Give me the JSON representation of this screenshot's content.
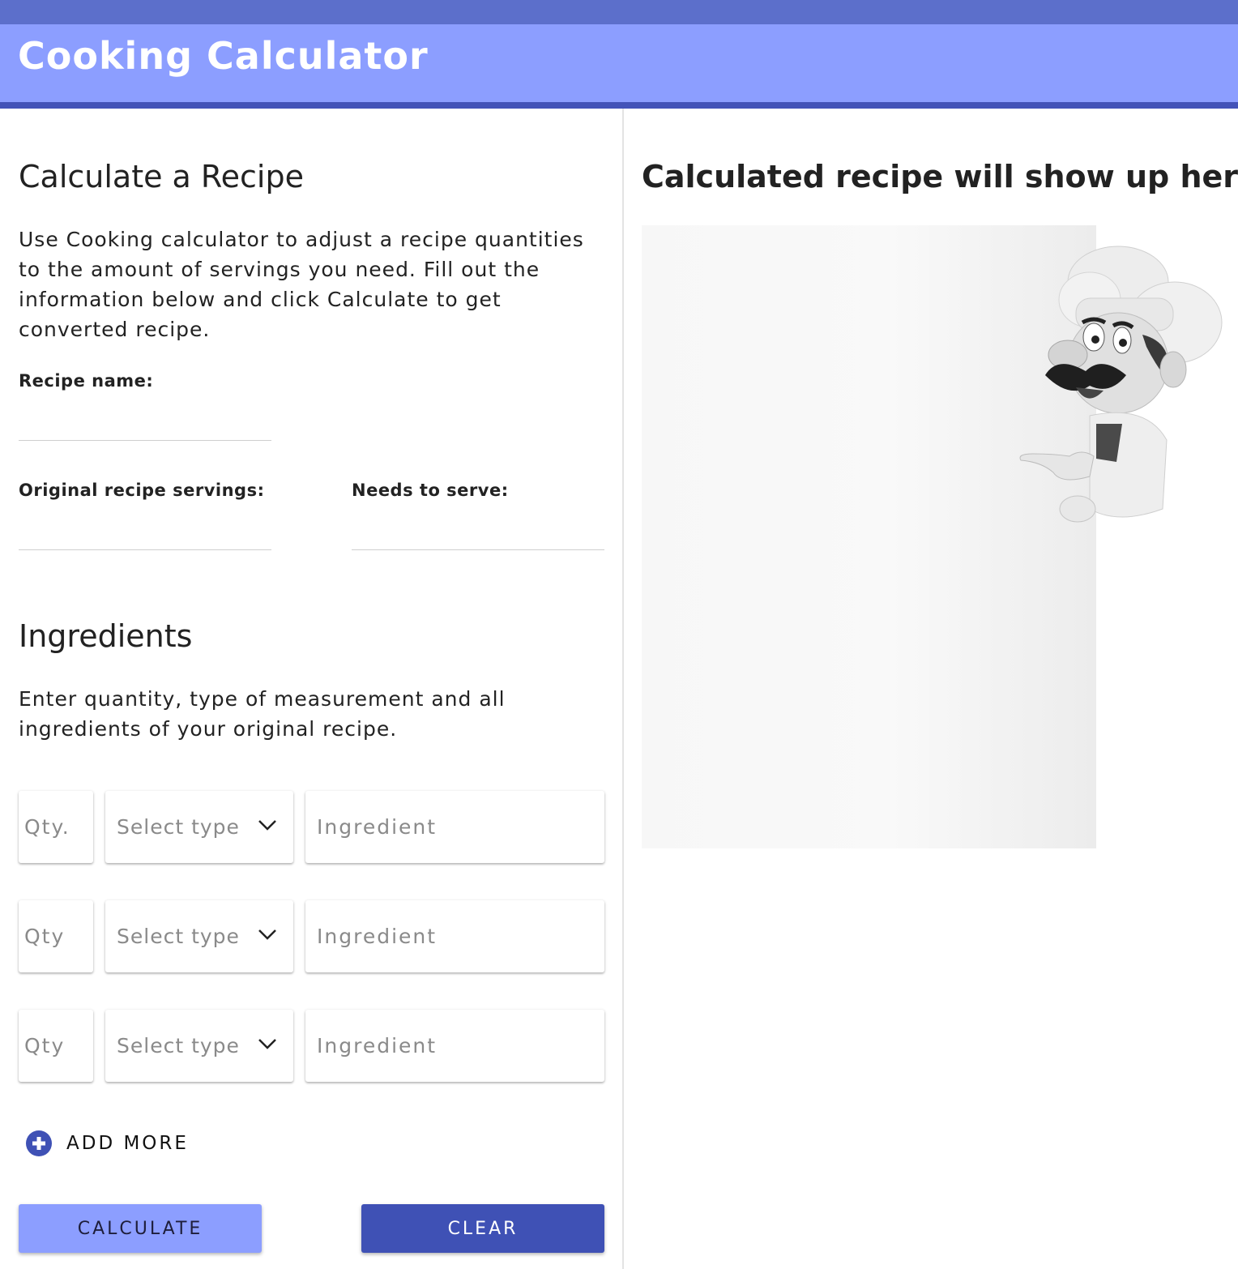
{
  "app": {
    "title": "Cooking Calculator"
  },
  "calculator": {
    "heading": "Calculate a Recipe",
    "description": "Use Cooking calculator to adjust a recipe quantities to the amount of servings you need. Fill out the information below and click Calculate to get converted recipe.",
    "recipe_name_label": "Recipe name:",
    "recipe_name_value": "",
    "original_servings_label": "Original recipe servings:",
    "original_servings_value": "",
    "needs_to_serve_label": "Needs to serve:",
    "needs_to_serve_value": ""
  },
  "ingredients": {
    "heading": "Ingredients",
    "description": "Enter quantity, type of measurement and all ingredients of your original recipe.",
    "rows": [
      {
        "qty_placeholder": "Qty.",
        "type_placeholder": "Select type",
        "ingredient_placeholder": "Ingredient"
      },
      {
        "qty_placeholder": "Qty",
        "type_placeholder": "Select type",
        "ingredient_placeholder": "Ingredient"
      },
      {
        "qty_placeholder": "Qty",
        "type_placeholder": "Select type",
        "ingredient_placeholder": "Ingredient"
      }
    ],
    "add_more_label": "ADD MORE"
  },
  "actions": {
    "calculate_label": "CALCULATE",
    "clear_label": "CLEAR"
  },
  "result": {
    "heading": "Calculated recipe will show up here"
  },
  "icons": {
    "add": "plus-circle-icon",
    "dropdown": "chevron-down-icon",
    "illustration": "chef-illustration"
  },
  "colors": {
    "header_bg": "#8c9eff",
    "header_border": "#4353b8",
    "top_strip": "#5c6fcb",
    "primary_button": "#8c9eff",
    "secondary_button": "#3f51b5",
    "add_icon": "#3f51b5"
  }
}
